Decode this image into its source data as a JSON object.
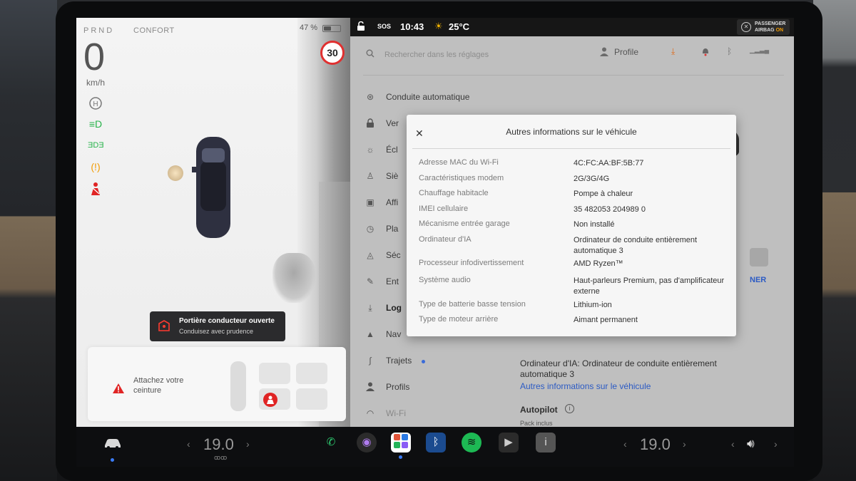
{
  "drive": {
    "gear": "PRND",
    "mode": "CONFORT",
    "battery_pct": "47 %",
    "battery_fraction": 0.47,
    "speed": "0",
    "speed_unit": "km/h",
    "speed_limit": "30",
    "alert_title": "Portière conducteur ouverte",
    "alert_sub": "Conduisez avec prudence",
    "seatbelt_text": "Attachez votre ceinture"
  },
  "status": {
    "sos": "SOS",
    "time": "10:43",
    "temp": "25°C",
    "airbag_line1": "PASSENGER",
    "airbag_line2a": "AIRBAG",
    "airbag_line2b": "ON"
  },
  "settings": {
    "search_placeholder": "Rechercher dans les réglages",
    "profile_label": "Profile",
    "menu": [
      {
        "label": "Conduite automatique",
        "icon": "steering-wheel-icon"
      },
      {
        "label": "Ver",
        "icon": "lock-icon"
      },
      {
        "label": "Écl",
        "icon": "sun-icon"
      },
      {
        "label": "Siè",
        "icon": "seat-icon"
      },
      {
        "label": "Affi",
        "icon": "display-icon"
      },
      {
        "label": "Pla",
        "icon": "clock-icon"
      },
      {
        "label": "Séc",
        "icon": "shield-icon"
      },
      {
        "label": "Ent",
        "icon": "wrench-icon"
      },
      {
        "label": "Log",
        "icon": "download-icon"
      },
      {
        "label": "Nav",
        "icon": "navigation-icon"
      },
      {
        "label": "Trajets",
        "icon": "trips-icon"
      },
      {
        "label": "Profils",
        "icon": "person-icon"
      },
      {
        "label": "Wi-Fi",
        "icon": "wifi-icon"
      }
    ],
    "right_fragment": "NER",
    "content_line1": "Ordinateur d'IA: Ordinateur de conduite entièrement",
    "content_line2": "automatique 3",
    "link": "Autres informations sur le véhicule",
    "autopilot": "Autopilot",
    "pack": "Pack inclus"
  },
  "modal": {
    "title": "Autres informations sur le véhicule",
    "rows": [
      {
        "k": "Adresse MAC du Wi-Fi",
        "v": "4C:FC:AA:BF:5B:77"
      },
      {
        "k": "Caractéristiques modem",
        "v": "2G/3G/4G"
      },
      {
        "k": "Chauffage habitacle",
        "v": "Pompe à chaleur"
      },
      {
        "k": "IMEI cellulaire",
        "v": "35 482053 204989 0"
      },
      {
        "k": "Mécanisme entrée garage",
        "v": "Non installé"
      },
      {
        "k": "Ordinateur d'IA",
        "v": "Ordinateur de conduite entièrement automatique 3"
      },
      {
        "k": "Processeur infodivertissement",
        "v": "AMD Ryzen™"
      },
      {
        "k": "Système audio",
        "v": "Haut-parleurs Premium, pas d'amplificateur externe"
      },
      {
        "k": "Type de batterie basse tension",
        "v": "Lithium-ion"
      },
      {
        "k": "Type de moteur arrière",
        "v": "Aimant permanent"
      }
    ]
  },
  "dock": {
    "temp_left": "19.0",
    "temp_right": "19.0"
  }
}
